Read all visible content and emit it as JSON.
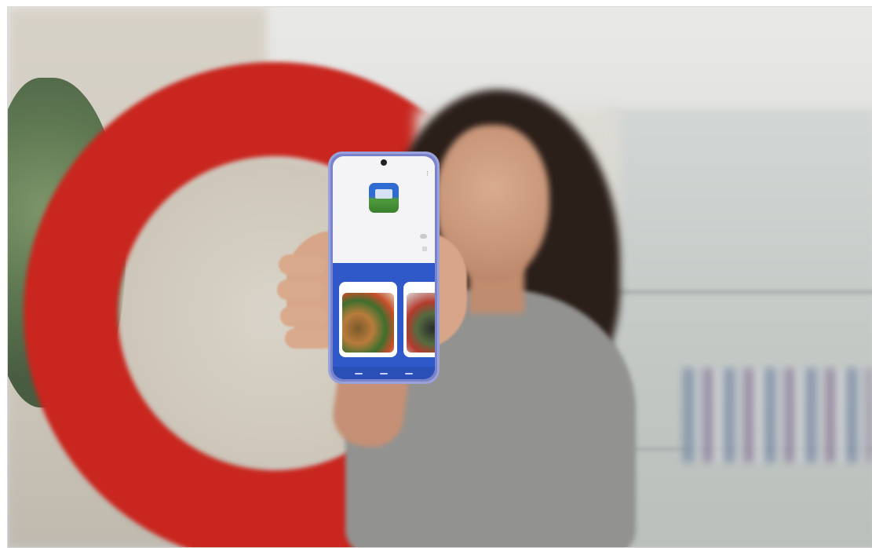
{
  "caption": {
    "text": ""
  },
  "scene": {
    "description": "",
    "colors": {
      "ring": "#c8261e",
      "phone_body": "#7a83c9",
      "app_section": "#2f58c9"
    }
  },
  "phone": {
    "status": {
      "time": "",
      "icons": ""
    },
    "app_logo_icon": "app-logo-icon",
    "rows": [
      {
        "label": ""
      },
      {
        "label": ""
      }
    ],
    "section": {
      "title": "",
      "cards": [
        {
          "title": ""
        },
        {
          "title": ""
        }
      ]
    }
  }
}
